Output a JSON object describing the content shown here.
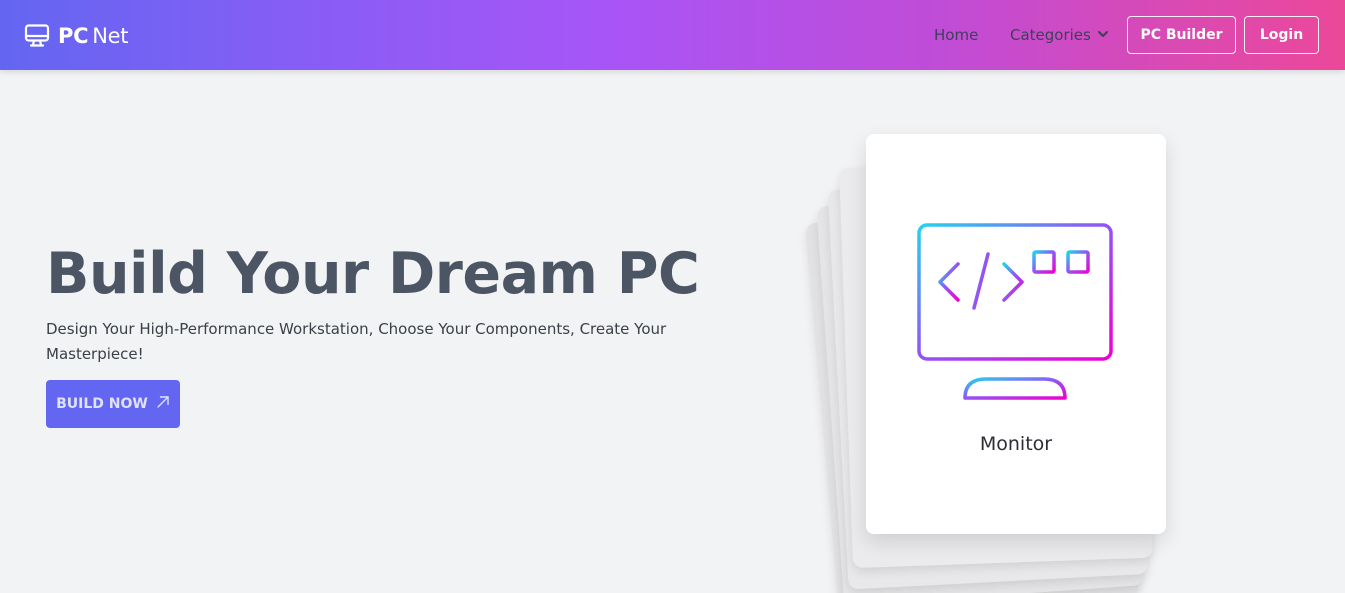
{
  "nav": {
    "brand_strong": "PC",
    "brand_light": "Net",
    "brand_icon": "monitor-icon",
    "home": "Home",
    "categories": "Categories",
    "categories_icon": "chevron-down-icon",
    "pc_builder": "PC Builder",
    "login": "Login"
  },
  "hero": {
    "title": "Build Your Dream PC",
    "subtitle": "Design Your High-Performance Workstation, Choose Your Components, Create Your Masterpiece!",
    "cta": "BUILD NOW",
    "cta_icon": "arrow-up-right-icon"
  },
  "card": {
    "label": "Monitor",
    "icon": "code-monitor-icon"
  },
  "colors": {
    "nav_gradient_start": "#6366f1",
    "nav_gradient_mid": "#a855f7",
    "nav_gradient_end": "#ec4899",
    "cta_bg": "#6366f1",
    "page_bg": "#f2f3f5",
    "title_color": "#4b5563"
  }
}
